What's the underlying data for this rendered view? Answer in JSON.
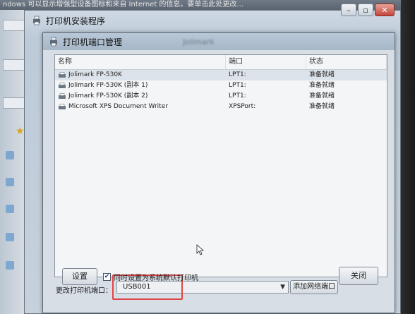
{
  "background": {
    "top_text": "ndows 可以显示增强型设备图标和来自 Internet 的信息。要单击此处更改..."
  },
  "installer_window": {
    "title": "打印机安装程序",
    "settings_label": "设置",
    "default_checkbox_label": "同时设置为系统默认打印机",
    "default_checked": true,
    "close_label": "关闭"
  },
  "port_manager": {
    "title": "打印机端口管理",
    "blurred_title_suffix": "Jolimark",
    "columns": {
      "name": "名称",
      "port": "端口",
      "status": "状态"
    },
    "printers": [
      {
        "name": "Jolimark FP-530K",
        "port": "LPT1:",
        "status": "准备就绪"
      },
      {
        "name": "Jolimark FP-530K (副本 1)",
        "port": "LPT1:",
        "status": "准备就绪"
      },
      {
        "name": "Jolimark FP-530K (副本 2)",
        "port": "LPT1:",
        "status": "准备就绪"
      },
      {
        "name": "Microsoft XPS Document Writer",
        "port": "XPSPort:",
        "status": "准备就绪"
      }
    ],
    "change_port_label": "更改打印机端口：",
    "selected_port": "USB001",
    "add_port_label": "添加网络端口"
  },
  "colors": {
    "highlight": "#e04545",
    "dialog_bg": "#d8dee6",
    "list_bg": "#f4f5f6"
  }
}
